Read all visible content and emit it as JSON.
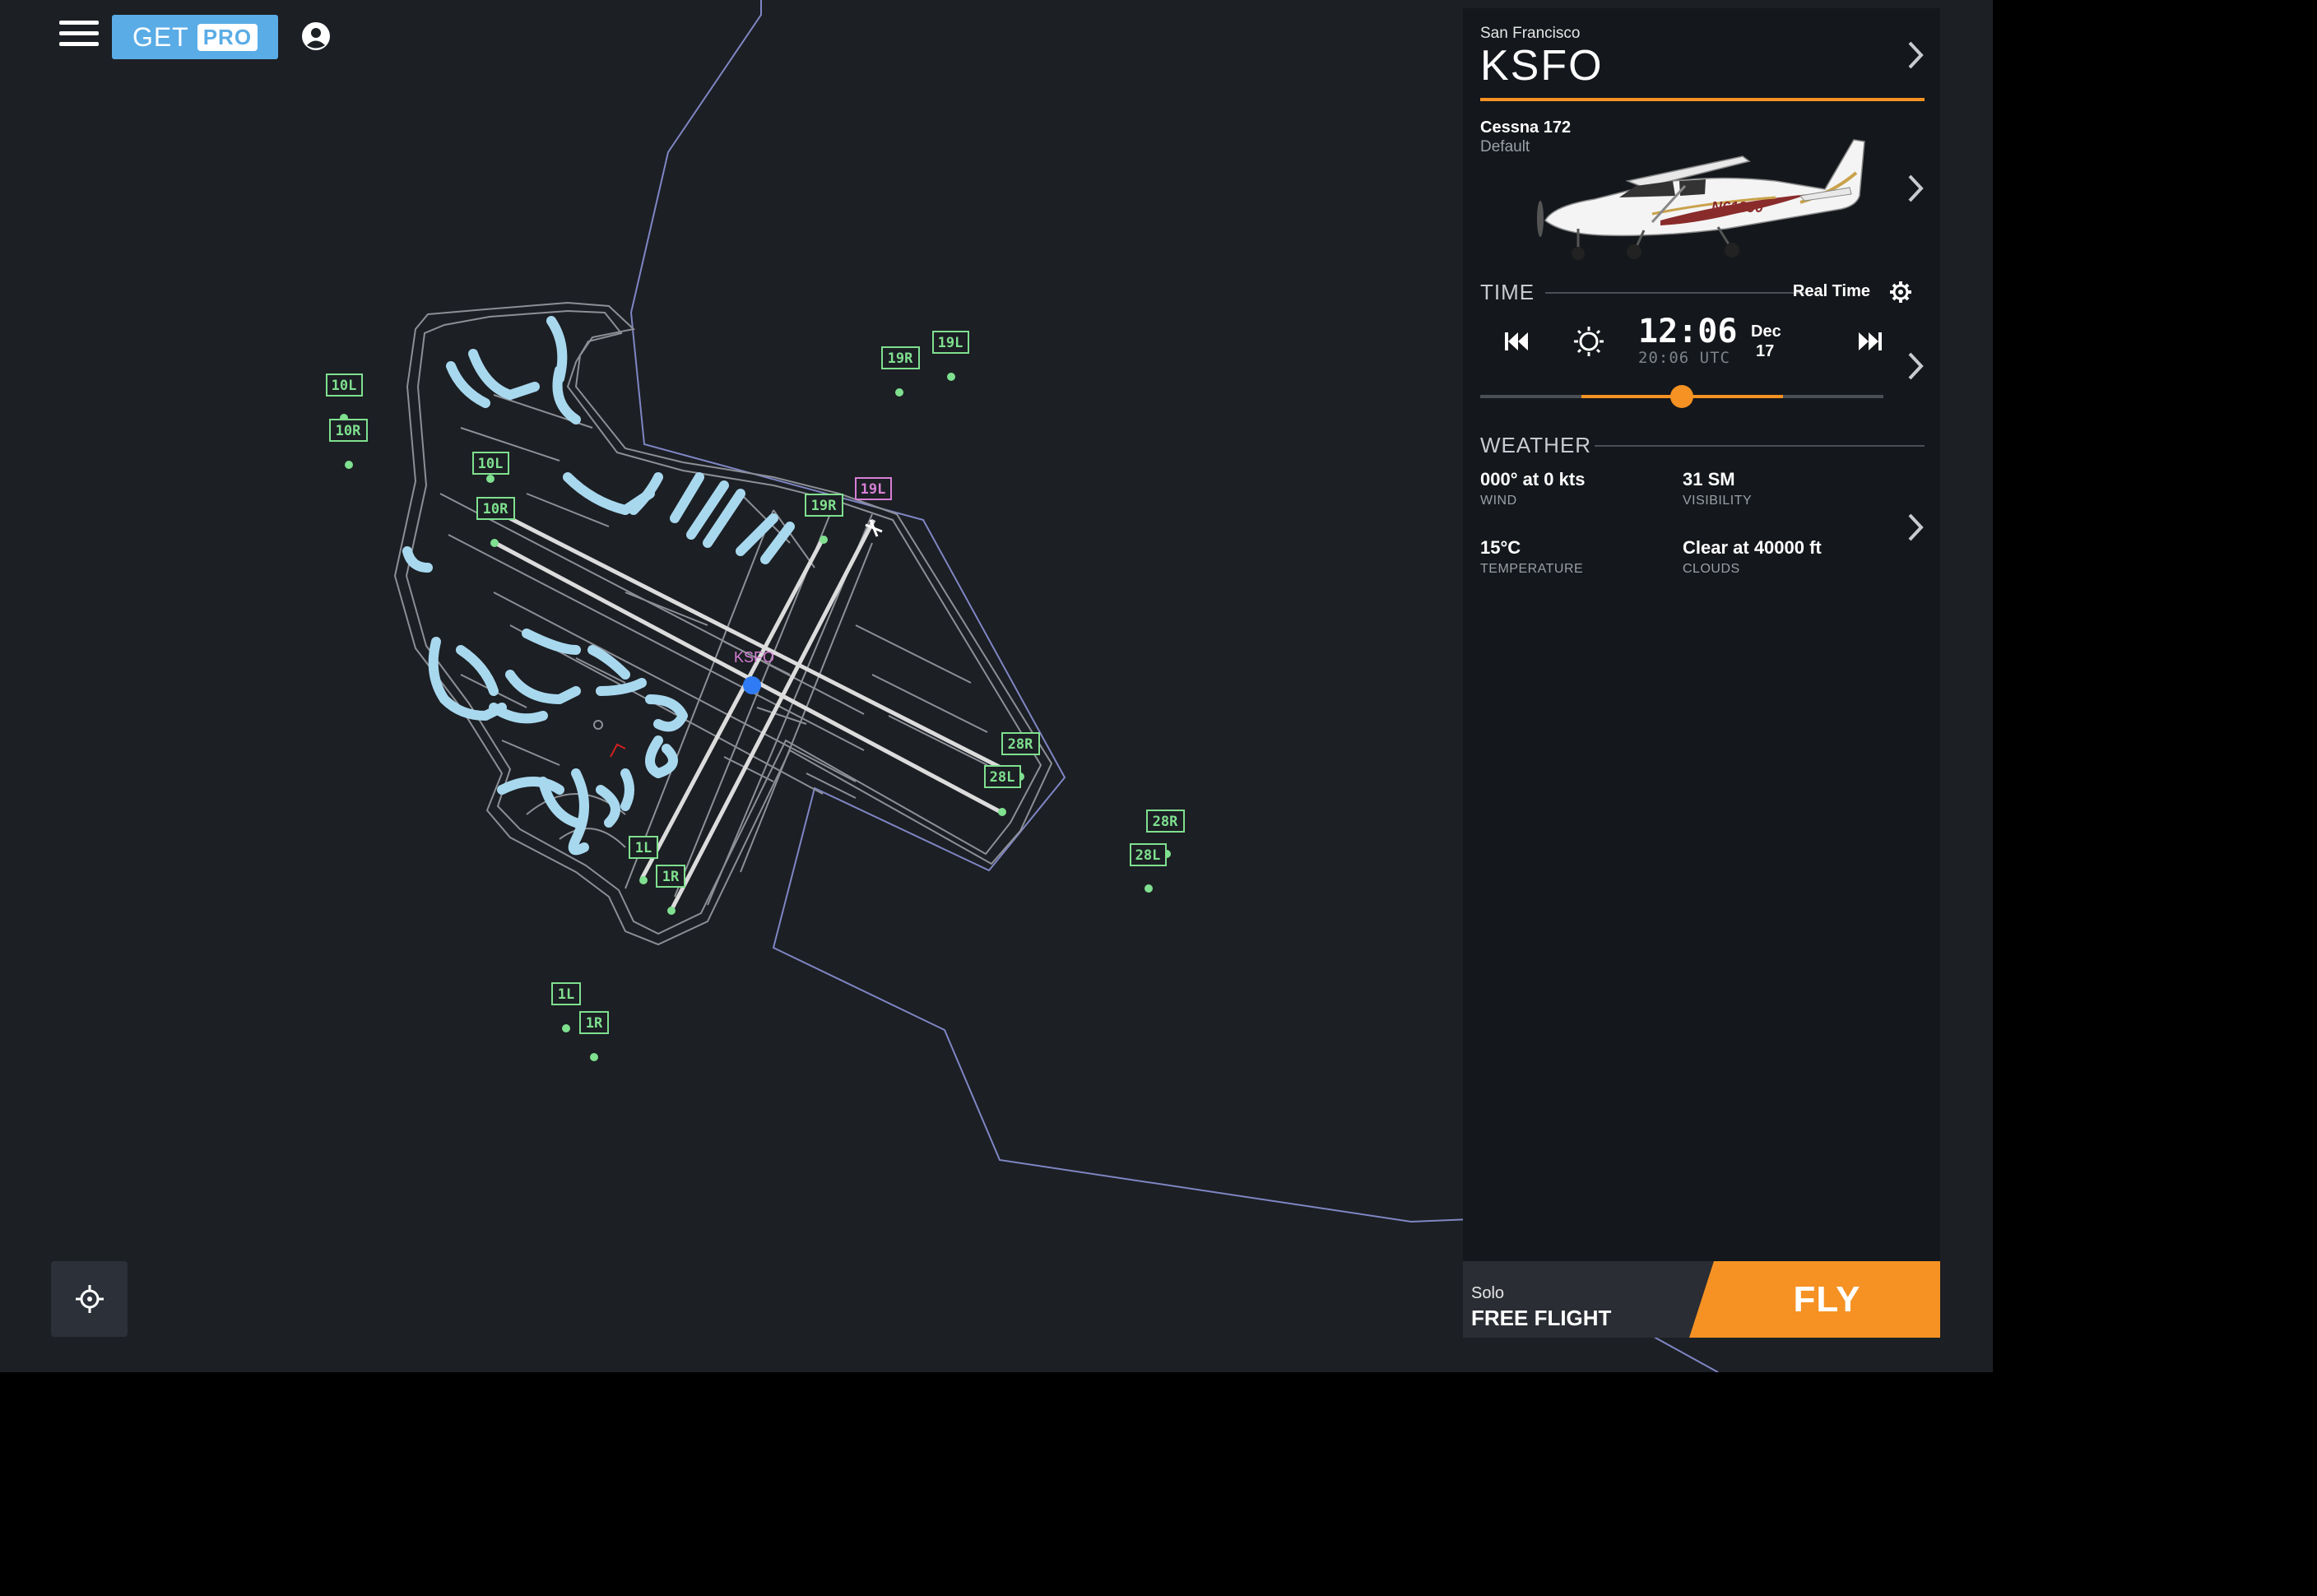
{
  "header": {
    "get_label": "GET",
    "pro_label": "PRO"
  },
  "airport": {
    "city": "San Francisco",
    "code": "KSFO",
    "map_label": "KSFO"
  },
  "aircraft": {
    "name": "Cessna 172",
    "livery": "Default",
    "registration": "N61890"
  },
  "time": {
    "title": "TIME",
    "mode": "Real Time",
    "local": "12:06",
    "utc": "20:06 UTC",
    "month": "Dec",
    "day": "17",
    "day_fraction": 0.5
  },
  "weather": {
    "title": "WEATHER",
    "wind": {
      "value": "000° at 0 kts",
      "caption": "WIND"
    },
    "visibility": {
      "value": "31 SM",
      "caption": "VISIBILITY"
    },
    "temperature": {
      "value": "15°C",
      "caption": "TEMPERATURE"
    },
    "clouds": {
      "value": "Clear at 40000 ft",
      "caption": "CLOUDS"
    }
  },
  "flight": {
    "mode_sub": "Solo",
    "mode": "FREE FLIGHT",
    "fly_label": "FLY"
  },
  "runway_labels": {
    "r10l_far": "10L",
    "r10r_far": "10R",
    "r10l": "10L",
    "r10r": "10R",
    "r19r_far": "19R",
    "r19l_far": "19L",
    "r19r": "19R",
    "r19l": "19L",
    "r28r": "28R",
    "r28l": "28L",
    "r28r_far": "28R",
    "r28l_far": "28L",
    "r1l": "1L",
    "r1r": "1R",
    "r1l_far": "1L",
    "r1r_far": "1R"
  },
  "colors": {
    "background": "#1c1f24",
    "panel": "#14171b",
    "accent": "#f59223",
    "pro_blue": "#5aace6",
    "runway_label": "#7fe08f",
    "selected_runway": "#d67fd6",
    "terminal": "#a8d8ee",
    "position_marker": "#2f7bf5"
  },
  "icons": {
    "menu": "hamburger-icon",
    "account": "account-icon",
    "recenter": "crosshair-icon",
    "chevron": "chevron-right-icon",
    "settings": "gear-icon",
    "sun": "sun-icon",
    "prev": "skip-back-icon",
    "next": "skip-forward-icon"
  }
}
